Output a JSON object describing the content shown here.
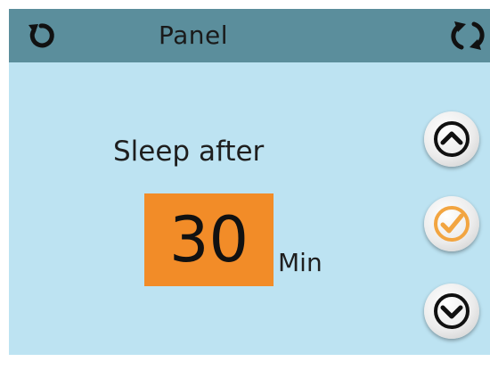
{
  "header": {
    "title": "Panel",
    "back_icon": "circular-back-arrow-icon",
    "swap_icon": "rotate-arrows-icon"
  },
  "main": {
    "label": "Sleep after",
    "value": "30",
    "unit": "Min",
    "value_background": "#f28c28"
  },
  "controls": {
    "up_icon": "chevron-up-icon",
    "confirm_icon": "check-icon",
    "down_icon": "chevron-down-icon",
    "confirm_color": "#f2a541"
  },
  "colors": {
    "background": "#bde3f2",
    "header_bar": "#5b8e9c"
  }
}
